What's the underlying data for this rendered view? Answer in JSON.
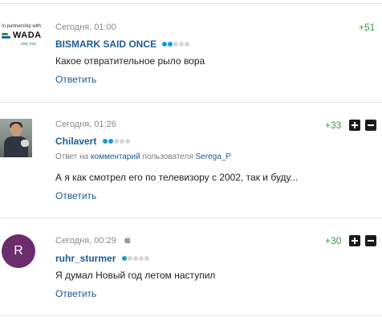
{
  "sponsor": {
    "partner_text": "In partnership with",
    "word": "WADA",
    "tagline": "play true"
  },
  "colors": {
    "author": "#1d5b93",
    "score_positive": "#3c9a3c",
    "dot_active": "#1a9bd7",
    "avatar_letter_bg": "#6b2d6b"
  },
  "comments": [
    {
      "date": "Сегодня, 01:00",
      "author": "BISMARK SAID ONCE",
      "rating_dots_active": 2,
      "rating_dots_total": 5,
      "text": "Какое отвратительное рыло вора",
      "reply_label": "Ответить",
      "score": "+51",
      "avatar_icon": "wada-logo"
    },
    {
      "date": "Сегодня, 01:26",
      "author": "Chilavert",
      "rating_dots_active": 2,
      "rating_dots_total": 5,
      "reply_prefix": "Ответ на",
      "reply_link": "комментарий",
      "reply_middle": "пользователя",
      "reply_user": "Serega_P",
      "text": "А я как смотрел его по телевизору с 2002, так и буду...",
      "reply_label": "Ответить",
      "score": "+33",
      "avatar_icon": "goalkeeper-photo"
    },
    {
      "date": "Сегодня, 00:29",
      "device_icon": "apple-icon",
      "author": "ruhr_sturmer",
      "rating_dots_active": 1,
      "rating_dots_total": 5,
      "text": "Я думал Новый год летом наступил",
      "reply_label": "Ответить",
      "score": "+30",
      "avatar_letter": "R"
    }
  ]
}
